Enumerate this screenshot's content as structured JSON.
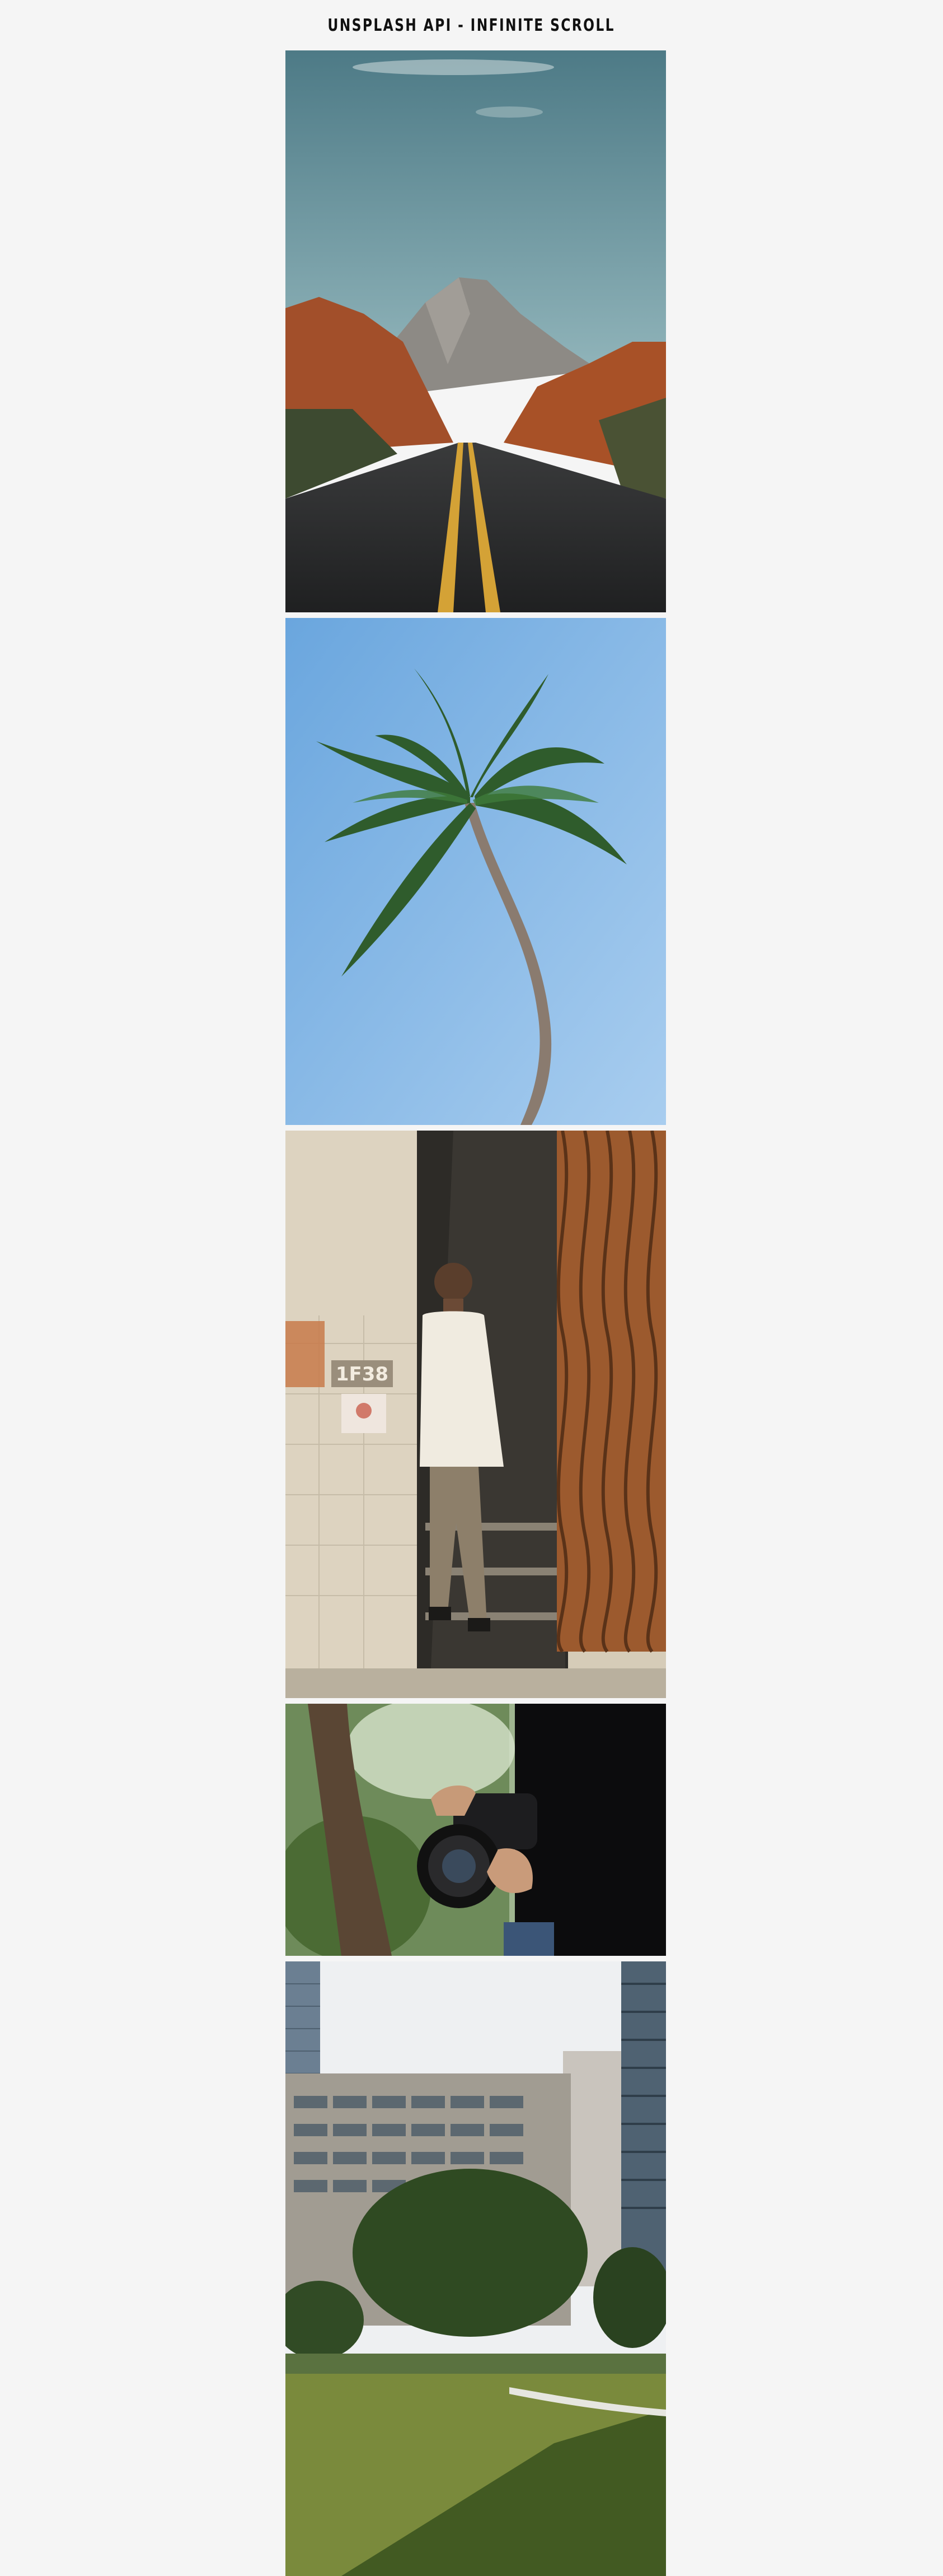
{
  "header": {
    "title": "UNSPLASH API - INFINITE SCROLL"
  },
  "gallery": {
    "images": [
      {
        "subject": "desert road leading to a rocky mountain"
      },
      {
        "subject": "single palm tree against blue sky"
      },
      {
        "subject": "man leaning in stairwell doorway beside 1F38 sign"
      },
      {
        "subject": "hands holding a camera"
      },
      {
        "subject": "office buildings behind park trees and lawn"
      }
    ]
  },
  "sign_text": "1F38",
  "colors": {
    "background": "#f5f5f5",
    "title": "#111111"
  }
}
